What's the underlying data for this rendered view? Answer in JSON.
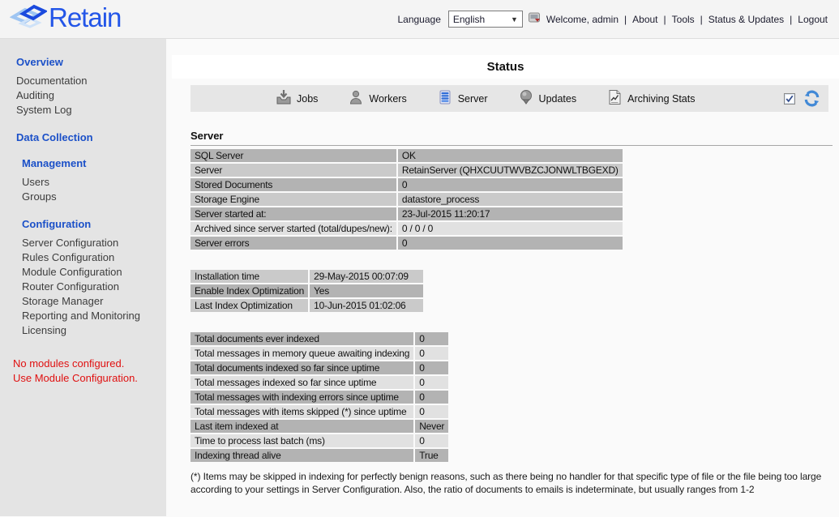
{
  "header": {
    "logo_text": "Retain",
    "language_label": "Language",
    "language_selected": "English",
    "welcome_text": "Welcome, admin",
    "separator": "|",
    "nav_links": [
      "About",
      "Tools",
      "Status & Updates",
      "Logout"
    ]
  },
  "sidebar": {
    "groups": [
      {
        "title": "Overview",
        "items": [
          "Documentation",
          "Auditing",
          "System Log"
        ]
      },
      {
        "title": "Data Collection",
        "items": []
      },
      {
        "title": "Management",
        "items": [
          "Users",
          "Groups"
        ]
      },
      {
        "title": "Configuration",
        "items": [
          "Server Configuration",
          "Rules Configuration",
          "Module Configuration",
          "Router Configuration",
          "Storage Manager",
          "Reporting and Monitoring",
          "Licensing"
        ]
      }
    ],
    "notice": "No modules configured. Use Module Configuration."
  },
  "main": {
    "page_title": "Status",
    "toolbar": {
      "buttons": [
        {
          "label": "Jobs",
          "icon": "jobs-icon"
        },
        {
          "label": "Workers",
          "icon": "workers-icon"
        },
        {
          "label": "Server",
          "icon": "server-icon"
        },
        {
          "label": "Updates",
          "icon": "updates-icon"
        },
        {
          "label": "Archiving Stats",
          "icon": "archiving-stats-icon"
        }
      ],
      "auto_refresh_checkbox_checked": true
    },
    "section_title": "Server",
    "server_table": {
      "rows": [
        {
          "label": "SQL Server",
          "value": "OK"
        },
        {
          "label": "Server",
          "value": "RetainServer (QHXCUUTWVBZCJONWLTBGEXD)"
        },
        {
          "label": "Stored Documents",
          "value": "0"
        },
        {
          "label": "Storage Engine",
          "value": "datastore_process"
        },
        {
          "label": "Server started at:",
          "value": "23-Jul-2015 11:20:17"
        },
        {
          "label": "Archived since server started (total/dupes/new):",
          "value": "0 / 0 / 0"
        },
        {
          "label": "Server errors",
          "value": "0"
        }
      ]
    },
    "install_table": {
      "rows": [
        {
          "label": "Installation time",
          "value": "29-May-2015 00:07:09"
        },
        {
          "label": "Enable Index Optimization",
          "value": "Yes"
        },
        {
          "label": "Last Index Optimization",
          "value": "10-Jun-2015 01:02:06"
        }
      ]
    },
    "indexing_table": {
      "rows": [
        {
          "label": "Total documents ever indexed",
          "value": "0"
        },
        {
          "label": "Total messages in memory queue awaiting indexing",
          "value": "0"
        },
        {
          "label": "Total documents indexed so far since uptime",
          "value": "0"
        },
        {
          "label": "Total messages indexed so far since uptime",
          "value": "0"
        },
        {
          "label": "Total messages with indexing errors since uptime",
          "value": "0"
        },
        {
          "label": "Total messages with items skipped (*) since uptime",
          "value": "0"
        },
        {
          "label": "Last item indexed at",
          "value": "Never"
        },
        {
          "label": "Time to process last batch (ms)",
          "value": "0"
        },
        {
          "label": "Indexing thread alive",
          "value": "True"
        }
      ]
    },
    "footnote": "(*) Items may be skipped in indexing for perfectly benign reasons, such as there being no handler for that specific type of file or the file being too large according to your settings in Server Configuration. Also, the ratio of documents to emails is indeterminate, but usually ranges from 1-2"
  },
  "colors": {
    "sidebar_heading_blue": "#1b50c8",
    "logo_blue": "#2456e8",
    "notice_red": "#e01010",
    "row_dark": "#b3b3b3",
    "row_mid": "#cacaca",
    "row_light": "#e1e1e1",
    "toolbar_gray": "#e6e6e6",
    "refresh_blue": "#4289d6"
  }
}
